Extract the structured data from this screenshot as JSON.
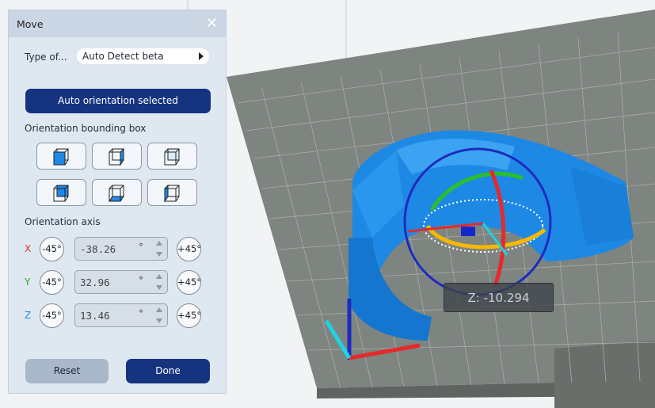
{
  "panel": {
    "title": "Move",
    "type_label": "Type of...",
    "type_value": "Auto Detect beta",
    "auto_button": "Auto orientation selected",
    "bbox_label": "Orientation bounding box",
    "axis_label": "Orientation axis",
    "axes": [
      {
        "name": "X",
        "minus": "-45°",
        "value": "-38.26",
        "unit": "°",
        "plus": "+45°",
        "color": "#e0322b"
      },
      {
        "name": "Y",
        "minus": "-45°",
        "value": "32.96",
        "unit": "°",
        "plus": "+45°",
        "color": "#2ea82e"
      },
      {
        "name": "Z",
        "minus": "-45°",
        "value": "13.46",
        "unit": "°",
        "plus": "+45°",
        "color": "#2a8ed8"
      }
    ],
    "reset": "Reset",
    "done": "Done"
  },
  "viewport": {
    "coordinate_readout": "Z: -10.294"
  },
  "colors": {
    "primary": "#15337f",
    "model": "#1e88e5",
    "bed": "#8d9390"
  },
  "icons": [
    "close-icon",
    "chevron-right-icon",
    "cube-icon",
    "stepper-up-icon",
    "stepper-down-icon"
  ]
}
